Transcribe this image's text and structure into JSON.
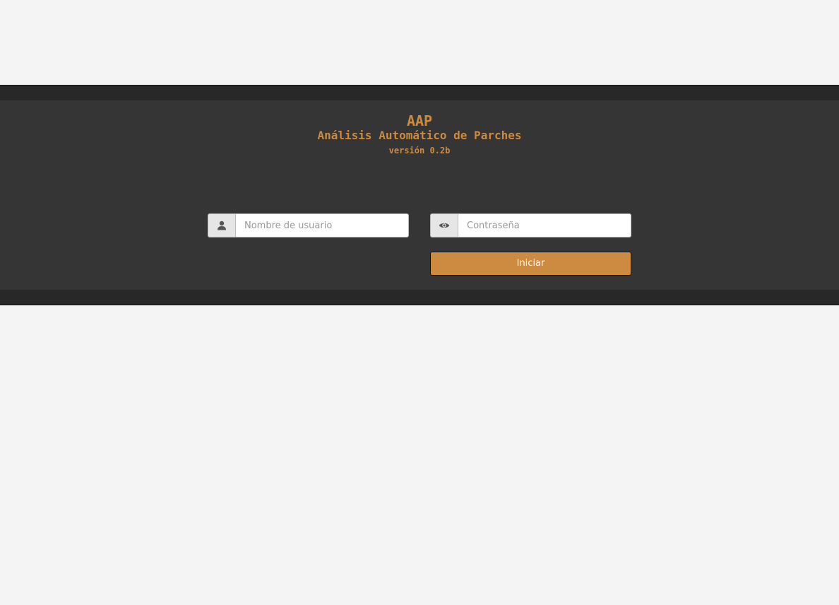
{
  "header": {
    "app_name": "AAP",
    "app_fullname": "Análisis Automático de Parches",
    "version": "versión 0.2b"
  },
  "login": {
    "username": {
      "placeholder": "Nombre de usuario",
      "value": "",
      "icon": "user-icon"
    },
    "password": {
      "placeholder": "Contraseña",
      "value": "",
      "icon": "eye-icon"
    },
    "submit_label": "Iniciar"
  },
  "colors": {
    "accent": "#cc8b40",
    "band_dark": "#282828",
    "panel": "#353535",
    "page_bg": "#f4f4f4"
  }
}
